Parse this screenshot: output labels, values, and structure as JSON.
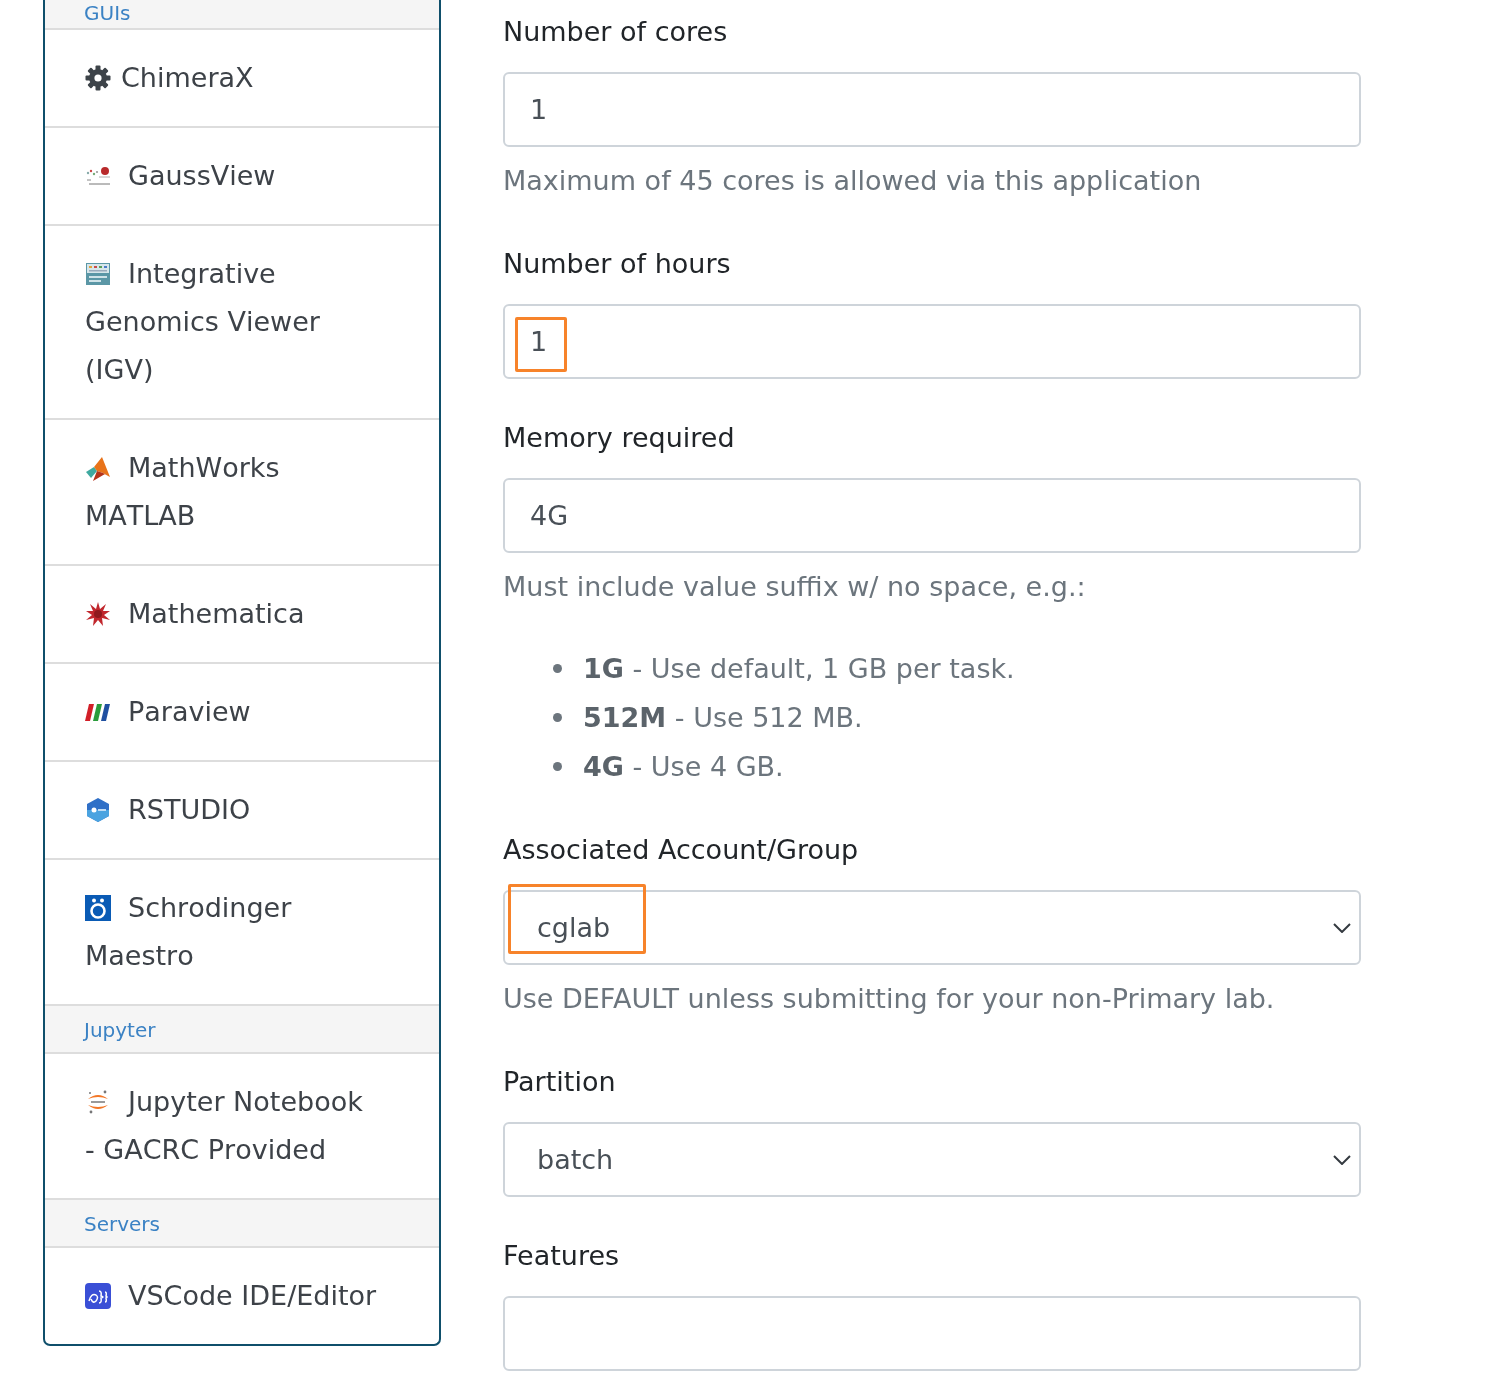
{
  "sidebar": {
    "sections": [
      {
        "heading": "GUIs",
        "items": [
          {
            "label": "ChimeraX"
          },
          {
            "label": "GaussView"
          },
          {
            "label": "Integrative Genomics Viewer (IGV)"
          },
          {
            "label": "MathWorks MATLAB"
          },
          {
            "label": "Mathematica"
          },
          {
            "label": "Paraview"
          },
          {
            "label": "RSTUDIO"
          },
          {
            "label": "Schrodinger Maestro"
          }
        ]
      },
      {
        "heading": "Jupyter",
        "items": [
          {
            "label": "Jupyter Notebook - GACRC Provided"
          }
        ]
      },
      {
        "heading": "Servers",
        "items": [
          {
            "label": "VSCode IDE/Editor"
          }
        ]
      }
    ]
  },
  "form": {
    "fields": [
      {
        "kind": "text",
        "label": "Number of cores",
        "value": "1",
        "highlighted": false,
        "help": "Maximum of 45 cores is allowed via this application"
      },
      {
        "kind": "text",
        "label": "Number of hours",
        "value": "1",
        "highlighted": true
      },
      {
        "kind": "text",
        "label": "Memory required",
        "value": "4G",
        "highlighted": false,
        "help": "Must include value suffix w/ no space, e.g.:",
        "help_list": [
          "**1G** - Use default, 1 GB per task.",
          "**512M** - Use 512 MB.",
          "**4G** - Use 4 GB."
        ]
      },
      {
        "kind": "select",
        "label": "Associated Account/Group",
        "value": "cglab",
        "highlighted": true,
        "help": "Use DEFAULT unless submitting for your non-Primary lab."
      },
      {
        "kind": "select",
        "label": "Partition",
        "value": "batch",
        "highlighted": false
      },
      {
        "kind": "text",
        "label": "Features",
        "highlighted": false
      }
    ]
  }
}
